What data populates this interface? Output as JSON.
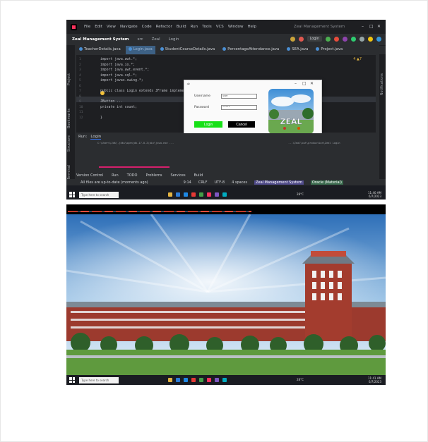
{
  "ide": {
    "menu": [
      "File",
      "Edit",
      "View",
      "Navigate",
      "Code",
      "Refactor",
      "Build",
      "Run",
      "Tools",
      "VCS",
      "Window",
      "Help"
    ],
    "window_title": "Zeal Management System",
    "project_name": "Zeal Management System",
    "breadcrumbs": [
      "src",
      "Zeal",
      "Login"
    ],
    "run_config": "Login",
    "tabs": [
      "TeacherDetails.java",
      "Login.java",
      "StudentCourseDetails.java",
      "PercentageAttendance.java",
      "SEA.java",
      "Project.java"
    ],
    "active_tab_index": 1,
    "warnings": "4  ▲7",
    "code_lines": [
      "import java.awt.*;",
      "import java.io.*;",
      "import java.awt.event.*;",
      "import java.sql.*;",
      "import javax.swing.*;",
      "",
      "public class Login extends JFrame implements ActionListener {",
      "",
      "    JButton ...",
      "    private int count;",
      "",
      "    }"
    ],
    "line_numbers": [
      "1",
      "2",
      "3",
      "4",
      "5",
      "6",
      "7",
      "8",
      "9",
      "10",
      "11",
      "12"
    ],
    "left_tools": [
      "Project",
      "Bookmarks",
      "Structure",
      "Terminal"
    ],
    "right_tools": [
      "Notifications"
    ],
    "run_panel": {
      "label": "Run:",
      "tab": "Login",
      "command_line": "C:\\Users\\Jdk\\.jdks\\openjdk-17.0.2\\bin\\java.exe ...",
      "command_tail": "...\\Zeal\\out\\production\\Zeal Login"
    },
    "bottom_tools": [
      "Version Control",
      "Run",
      "TODO",
      "Problems",
      "Services",
      "Build"
    ],
    "status": {
      "message": "All files are up-to-date (moments ago)",
      "position": "9:14",
      "line_sep": "CRLF",
      "encoding": "UTF-8",
      "indent": "4 spaces",
      "project_tag": "Zeal Management System",
      "db_tag": "Oracle (Material)"
    }
  },
  "login_dialog": {
    "username_label": "Username",
    "username_value": "user",
    "password_label": "Password",
    "password_value": "•••••",
    "login_button": "Login",
    "cancel_button": "Cancel",
    "photo_caption": "ZEAL"
  },
  "taskbar1": {
    "search_placeholder": "Type here to search",
    "weather": "28°C",
    "time": "11:40 AM",
    "date": "6/7/2023"
  },
  "taskbar2": {
    "search_placeholder": "Type here to search",
    "weather": "28°C",
    "time": "11:41 AM",
    "date": "6/7/2023"
  },
  "colors": {
    "login_green": "#16e016",
    "accent_blue": "#3574f0",
    "ide_bg": "#1e1f22"
  }
}
